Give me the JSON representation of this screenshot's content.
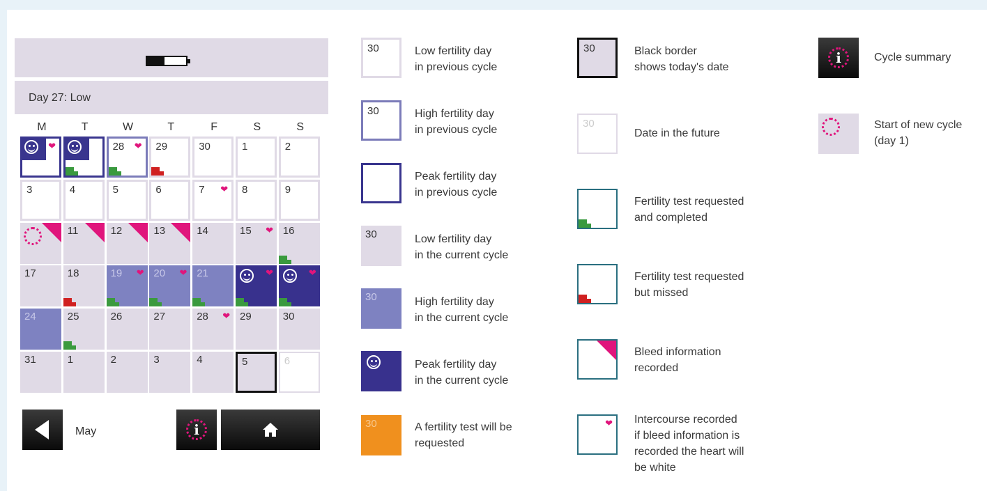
{
  "device": {
    "battery_level": 0.45,
    "status": "Day 27: Low",
    "weekdays": [
      "M",
      "T",
      "W",
      "T",
      "F",
      "S",
      "S"
    ],
    "month": "May",
    "days": [
      {
        "label": "",
        "type": "peakprev",
        "peak": true,
        "heart": true
      },
      {
        "label": "",
        "type": "peakprev",
        "peak": true,
        "test": "done"
      },
      {
        "label": "28",
        "type": "highprev",
        "heart": true,
        "test": "done"
      },
      {
        "label": "29",
        "type": "lowprev",
        "test": "miss"
      },
      {
        "label": "30",
        "type": "lowprev"
      },
      {
        "label": "1",
        "type": "lowprev"
      },
      {
        "label": "2",
        "type": "lowprev"
      },
      {
        "label": "3",
        "type": "lowprev"
      },
      {
        "label": "4",
        "type": "lowprev"
      },
      {
        "label": "5",
        "type": "lowprev"
      },
      {
        "label": "6",
        "type": "lowprev"
      },
      {
        "label": "7",
        "type": "lowprev",
        "heart": true
      },
      {
        "label": "8",
        "type": "lowprev"
      },
      {
        "label": "9",
        "type": "lowprev"
      },
      {
        "label": "",
        "type": "lowcur",
        "newcycle": true,
        "bleed": true
      },
      {
        "label": "11",
        "type": "lowcur",
        "bleed": true
      },
      {
        "label": "12",
        "type": "lowcur",
        "bleed": true
      },
      {
        "label": "13",
        "type": "lowcur",
        "bleed": true
      },
      {
        "label": "14",
        "type": "lowcur"
      },
      {
        "label": "15",
        "type": "lowcur",
        "heart": true
      },
      {
        "label": "16",
        "type": "lowcur",
        "test": "done"
      },
      {
        "label": "17",
        "type": "lowcur"
      },
      {
        "label": "18",
        "type": "lowcur",
        "test": "miss"
      },
      {
        "label": "19",
        "type": "highcur",
        "heart": true,
        "test": "done"
      },
      {
        "label": "20",
        "type": "highcur",
        "heart": true,
        "test": "done"
      },
      {
        "label": "21",
        "type": "highcur",
        "test": "done"
      },
      {
        "label": "",
        "type": "peakcur",
        "peak": true,
        "heart": true,
        "test": "done"
      },
      {
        "label": "",
        "type": "peakcur",
        "peak": true,
        "heart": true,
        "test": "done"
      },
      {
        "label": "24",
        "type": "highcur"
      },
      {
        "label": "25",
        "type": "lowcur",
        "test": "done"
      },
      {
        "label": "26",
        "type": "lowcur"
      },
      {
        "label": "27",
        "type": "lowcur"
      },
      {
        "label": "28",
        "type": "lowcur",
        "heart": true
      },
      {
        "label": "29",
        "type": "lowcur"
      },
      {
        "label": "30",
        "type": "lowcur"
      },
      {
        "label": "31",
        "type": "lowcur"
      },
      {
        "label": "1",
        "type": "lowcur"
      },
      {
        "label": "2",
        "type": "lowcur"
      },
      {
        "label": "3",
        "type": "lowcur"
      },
      {
        "label": "4",
        "type": "lowcur"
      },
      {
        "label": "5",
        "type": "today"
      },
      {
        "label": "6",
        "type": "future"
      }
    ]
  },
  "legend": {
    "low_prev": {
      "num": "30",
      "text": "Low fertility day\nin previous cycle"
    },
    "high_prev": {
      "num": "30",
      "text": "High fertility day\nin previous cycle"
    },
    "peak_prev": {
      "text": "Peak fertility day\nin previous cycle"
    },
    "low_cur": {
      "num": "30",
      "text": "Low fertility day\nin the current cycle"
    },
    "high_cur": {
      "num": "30",
      "text": "High fertility day\nin the current cycle"
    },
    "peak_cur": {
      "text": "Peak fertility day\nin the current cycle"
    },
    "test_requested": {
      "num": "30",
      "text": "A fertility test will be\nrequested",
      "color": "#f0901e"
    },
    "today": {
      "num": "30",
      "text": "Black border\nshows today's date"
    },
    "future": {
      "num": "30",
      "text": "Date in the future"
    },
    "test_done": {
      "text": "Fertility test requested\nand completed"
    },
    "test_missed": {
      "text": "Fertility test requested\nbut missed"
    },
    "bleed": {
      "text": "Bleed information\nrecorded"
    },
    "intercourse": {
      "text": "Intercourse recorded\nif bleed information is\nrecorded the heart will\nbe white"
    },
    "summary": {
      "text": "Cycle summary"
    },
    "new_cycle": {
      "text": "Start of new cycle\n(day 1)"
    }
  },
  "colors": {
    "low_prev_border": "#e0dae6",
    "high_prev_border": "#7b7bb9",
    "peak": "#38318d",
    "high_cur": "#7e82c1",
    "low_cur": "#e0dae6",
    "bleed": "#e0157c",
    "test_done": "#3a9a3e",
    "test_missed": "#d02020",
    "orange": "#f0901e"
  }
}
